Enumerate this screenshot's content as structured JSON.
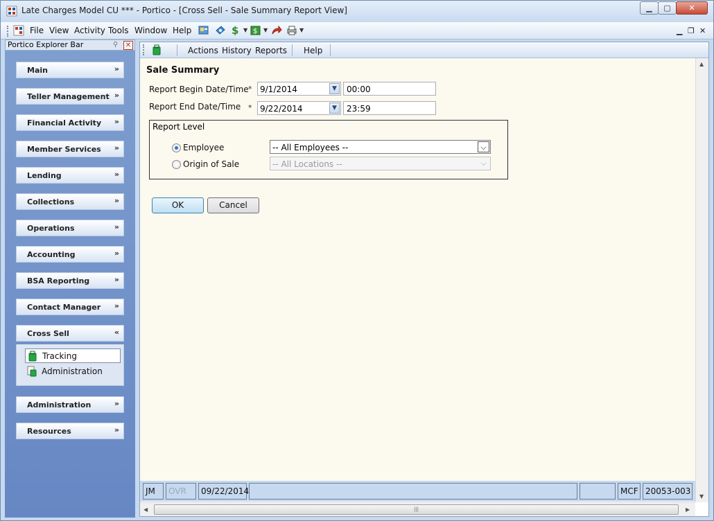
{
  "window": {
    "title": "Late Charges Model CU *** - Portico - [Cross Sell - Sale Summary Report View]",
    "min_glyph": "▁",
    "max_glyph": "▢",
    "close_glyph": "✕"
  },
  "menubar": {
    "items": [
      "File",
      "View",
      "Activity",
      "Tools",
      "Window",
      "Help"
    ],
    "mdi_min": "▁",
    "mdi_restore": "❐",
    "mdi_close": "✕"
  },
  "explorer": {
    "title": "Portico Explorer Bar",
    "sections": [
      {
        "label": "Main",
        "chevron": "»"
      },
      {
        "label": "Teller Management",
        "chevron": "»"
      },
      {
        "label": "Financial Activity",
        "chevron": "»"
      },
      {
        "label": "Member Services",
        "chevron": "»"
      },
      {
        "label": "Lending",
        "chevron": "»"
      },
      {
        "label": "Collections",
        "chevron": "»"
      },
      {
        "label": "Operations",
        "chevron": "»"
      },
      {
        "label": "Accounting",
        "chevron": "»"
      },
      {
        "label": "BSA Reporting",
        "chevron": "»"
      },
      {
        "label": "Contact Manager",
        "chevron": "»"
      },
      {
        "label": "Cross Sell",
        "chevron": "«"
      },
      {
        "label": "Administration",
        "chevron": "»"
      },
      {
        "label": "Resources",
        "chevron": "»"
      }
    ],
    "cross_sell_items": [
      {
        "label": "Tracking"
      },
      {
        "label": "Administration"
      }
    ]
  },
  "child_toolbar": {
    "items": [
      "Actions",
      "History",
      "Reports",
      "Help"
    ]
  },
  "form": {
    "heading": "Sale Summary",
    "begin_label": "Report Begin Date/Time",
    "end_label": "Report End Date/Time",
    "required_mark": "*",
    "begin_date": "9/1/2014",
    "begin_time": "00:00",
    "end_date": "9/22/2014",
    "end_time": "23:59",
    "group_title": "Report Level",
    "employee_label": "Employee",
    "origin_label": "Origin of Sale",
    "employee_value": "-- All Employees --",
    "location_value": "-- All Locations --",
    "ok_label": "OK",
    "cancel_label": "Cancel"
  },
  "status": {
    "user": "JM",
    "ovr": "OVR",
    "date": "09/22/2014",
    "branch": "MCF",
    "code": "20053-003"
  },
  "colors": {
    "content_bg": "#fcf9ef",
    "explorer_bg": "#7393ca",
    "frame_bg": "#c6d9ef"
  }
}
